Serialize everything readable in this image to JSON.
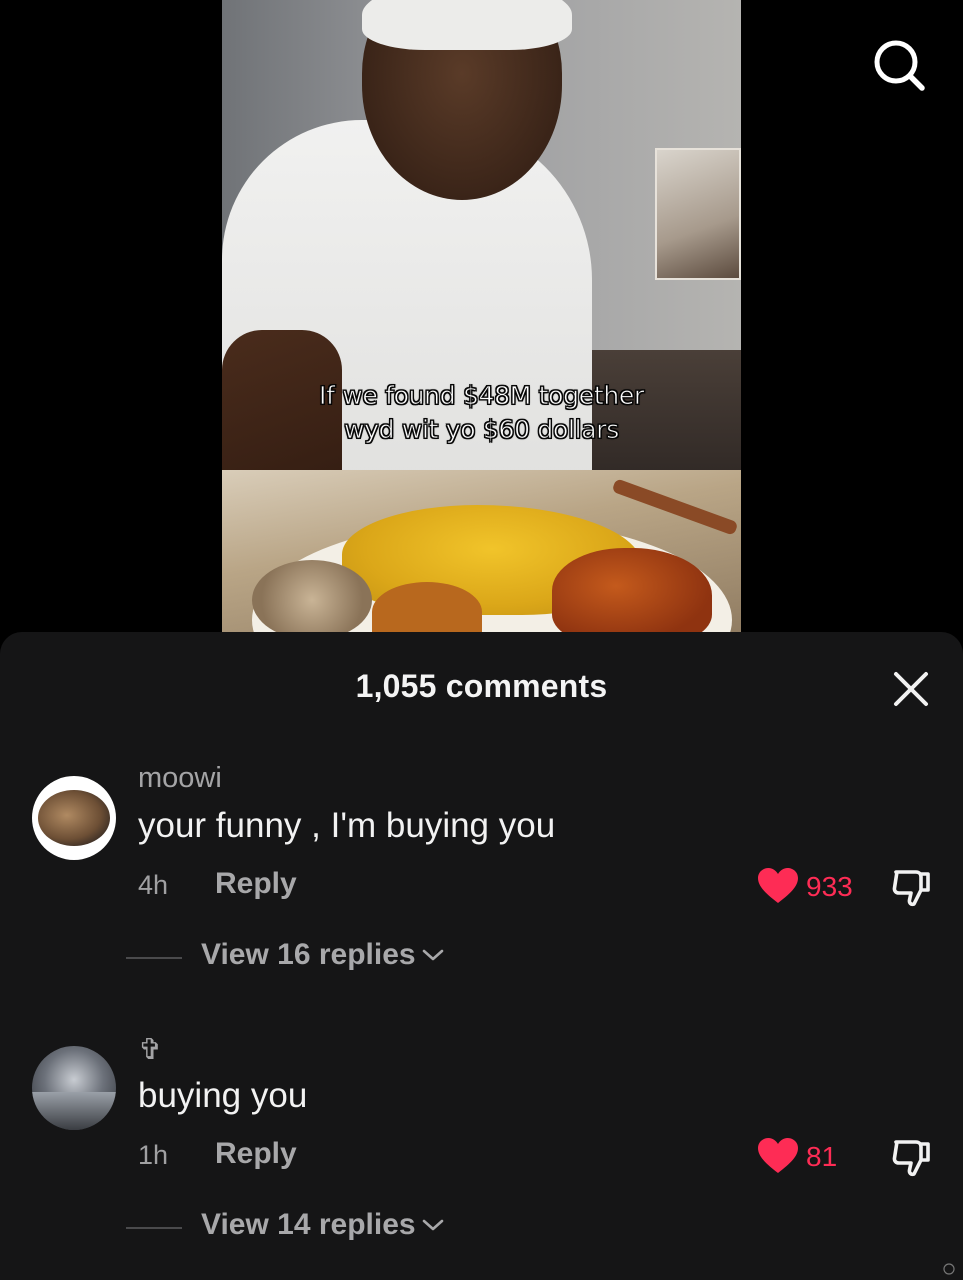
{
  "video": {
    "caption_line1": "If we found $48M together",
    "caption_line2": "wyd wit yo $60 dollars"
  },
  "top_bar": {
    "search_icon": "search-icon"
  },
  "comments_panel": {
    "title": "1,055 comments",
    "close_icon": "close-icon",
    "accent_color": "#fe2c55",
    "comments": [
      {
        "username": "moowi",
        "text": "your funny , I'm buying you",
        "time": "4h",
        "reply_label": "Reply",
        "likes": "933",
        "view_replies": "View 16 replies"
      },
      {
        "username": "✞",
        "text": "buying you",
        "time": "1h",
        "reply_label": "Reply",
        "likes": "81",
        "view_replies": "View 14 replies"
      }
    ]
  }
}
